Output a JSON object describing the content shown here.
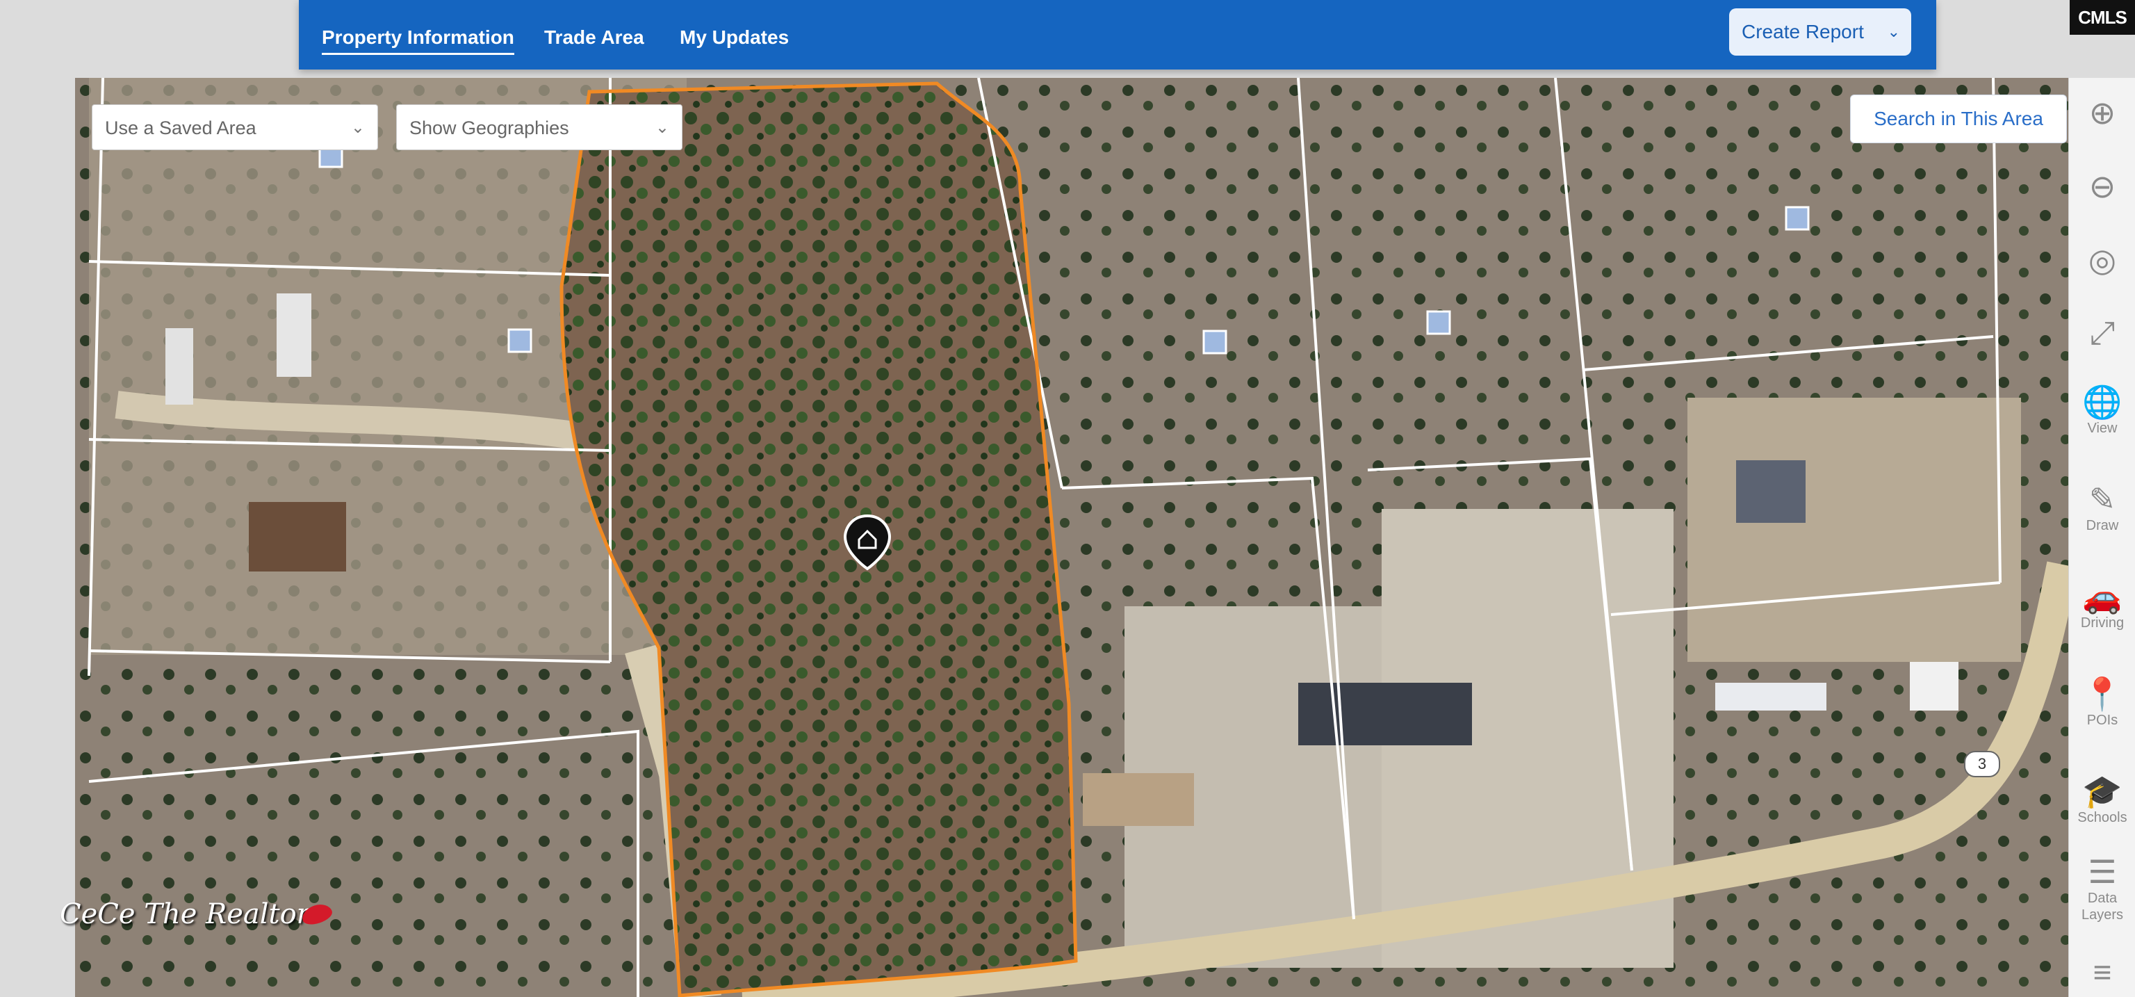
{
  "nav": {
    "tabs": [
      {
        "label": "Property Information",
        "active": true
      },
      {
        "label": "Trade Area",
        "active": false
      },
      {
        "label": "My Updates",
        "active": false
      }
    ],
    "create_report": "Create Report"
  },
  "logo": "CMLS",
  "map": {
    "saved_area_placeholder": "Use a Saved Area",
    "geographies_placeholder": "Show Geographies",
    "search_in_area": "Search in This Area",
    "route_marker": "3",
    "watermark": "CeCe The Realtor"
  },
  "rail": {
    "items": [
      {
        "icon": "zoom-in-icon",
        "label": ""
      },
      {
        "icon": "zoom-out-icon",
        "label": ""
      },
      {
        "icon": "locate-icon",
        "label": ""
      },
      {
        "icon": "fullscreen-icon",
        "label": ""
      },
      {
        "icon": "globe-icon",
        "label": "View"
      },
      {
        "icon": "pencil-icon",
        "label": "Draw"
      },
      {
        "icon": "car-icon",
        "label": "Driving"
      },
      {
        "icon": "pin-icon",
        "label": "POIs"
      },
      {
        "icon": "graduation-cap-icon",
        "label": "Schools"
      },
      {
        "icon": "layers-icon",
        "label": "Data Layers"
      },
      {
        "icon": "list-icon",
        "label": ""
      }
    ]
  },
  "colors": {
    "brand_blue": "#1565c0",
    "parcel_highlight": "#f08a24",
    "parcel_lines": "#ffffff"
  }
}
